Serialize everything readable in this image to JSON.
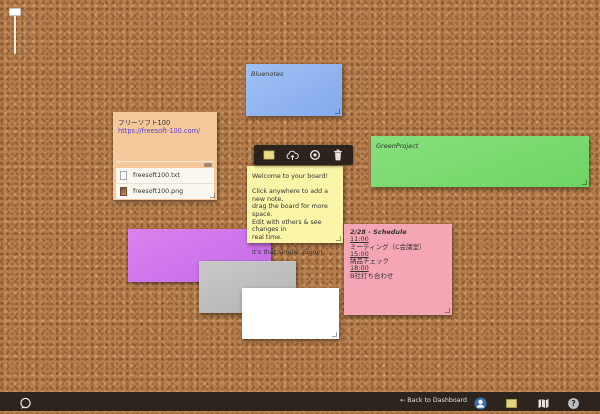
{
  "notes": {
    "blue": {
      "text": "Bluenotes"
    },
    "orange": {
      "title": "フリーソフト100",
      "url": "https://freesoft-100.com/",
      "files": [
        {
          "name": "freesoft100.txt",
          "icon": "text-file-icon"
        },
        {
          "name": "freesoft100.png",
          "icon": "image-file-icon"
        }
      ]
    },
    "green": {
      "text": "GreenProject"
    },
    "yellow": {
      "lines": [
        "Welcome to your board!",
        "",
        "Click anywhere to add a new note,",
        "drag the board for more space.",
        "Edit with others & see changes in",
        "real time.",
        "",
        "It's that simple. Enjoy!"
      ]
    },
    "pink": {
      "title": "2/28 - Schedule",
      "items": [
        {
          "time": "11:00",
          "text": "ミーティング（C会議室）"
        },
        {
          "time": "15:00",
          "text": "納品チェック"
        },
        {
          "time": "18:00",
          "text": "B社打ち合わせ"
        }
      ]
    }
  },
  "toolbar": {
    "icons": [
      "note-color-icon",
      "upload-icon",
      "settings-icon",
      "trash-icon"
    ]
  },
  "bottombar": {
    "back_label": "← Back to Dashboard",
    "icons": [
      "chat-icon",
      "user-icon",
      "notes-icon",
      "map-icon",
      "help-icon"
    ]
  },
  "colors": {
    "cork": "#b57d4c",
    "blue_note": "#8fb2ee",
    "orange_note": "#f4c89a",
    "green_note": "#77d86d",
    "yellow_note": "#fbf5a8",
    "pink_note": "#f5a6b4",
    "purple_note": "#cf74ea",
    "gray_note": "#bdbdbd",
    "white_note": "#ffffff",
    "toolbar_bg": "#2c231d"
  }
}
